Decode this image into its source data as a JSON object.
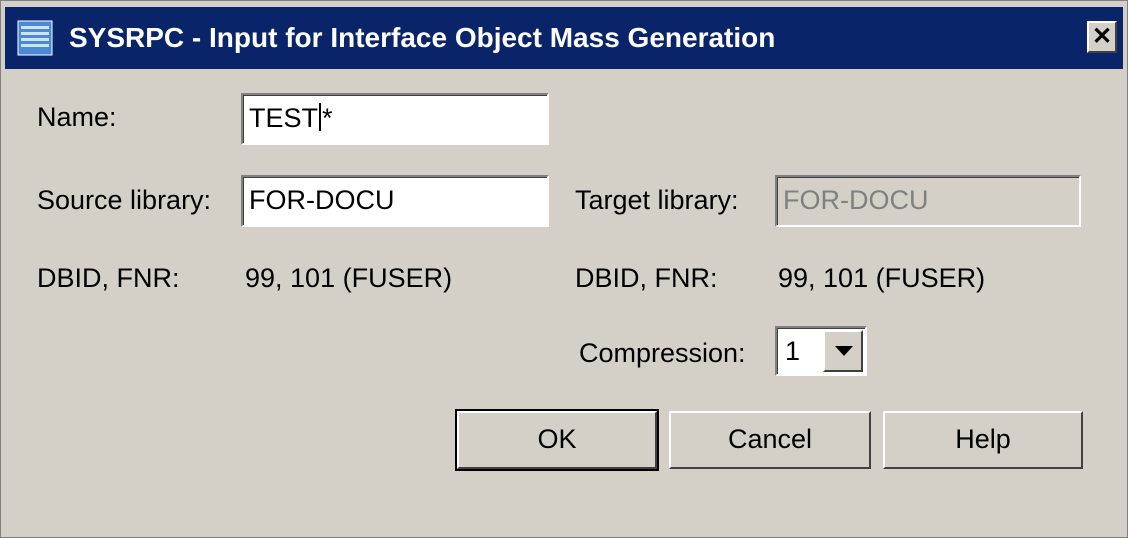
{
  "window": {
    "title": "SYSRPC - Input for Interface Object Mass Generation",
    "close_label": "✕"
  },
  "form": {
    "name_label": "Name:",
    "name_value_before_caret": "TEST",
    "name_value_after_caret": "*",
    "source_library_label": "Source library:",
    "source_library_value": "FOR-DOCU",
    "target_library_label": "Target library:",
    "target_library_value": "FOR-DOCU",
    "source_dbid_label": "DBID, FNR:",
    "source_dbid_value": "99, 101  (FUSER)",
    "target_dbid_label": "DBID, FNR:",
    "target_dbid_value": "99, 101  (FUSER)",
    "compression_label": "Compression:",
    "compression_value": "1"
  },
  "buttons": {
    "ok": "OK",
    "cancel": "Cancel",
    "help": "Help"
  },
  "colors": {
    "titlebar": "#0a246a",
    "dialog": "#d4d0c8",
    "disabled_text": "#808080"
  },
  "icons": {
    "app": "window-app-icon",
    "close": "close-icon",
    "dropdown": "chevron-down-icon"
  }
}
